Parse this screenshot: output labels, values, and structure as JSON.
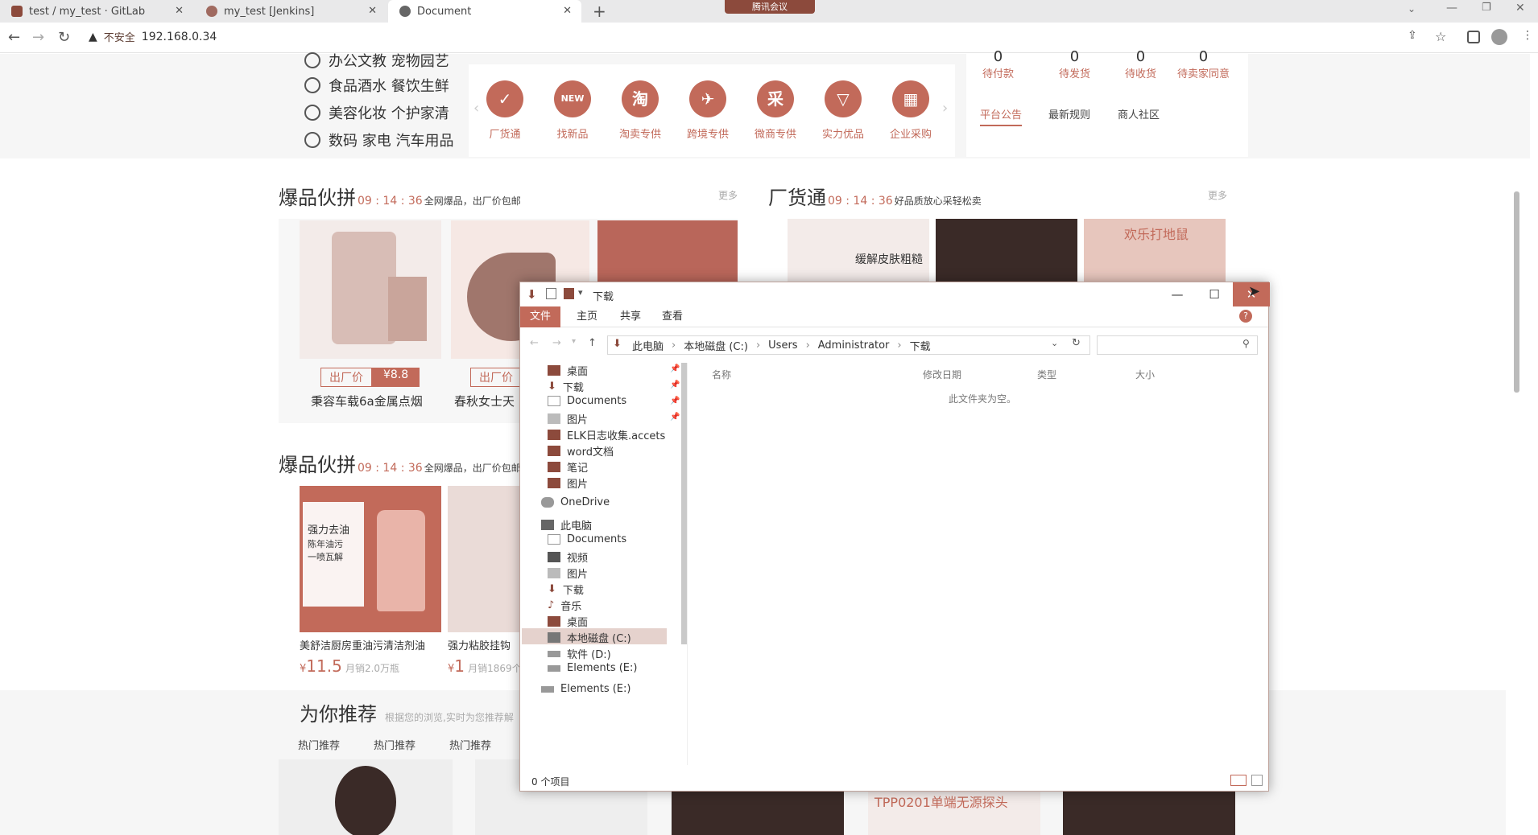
{
  "browser": {
    "tabs": [
      {
        "title": "test / my_test · GitLab",
        "color": "#8c4a3c"
      },
      {
        "title": "my_test [Jenkins]",
        "color": "#a06a60"
      },
      {
        "title": "Document",
        "color": "#666666"
      }
    ],
    "meeting_badge": "腾讯会议",
    "security_label": "不安全",
    "url": "192.168.0.34"
  },
  "page": {
    "categories": [
      "办公文教 宠物园艺",
      "食品酒水 餐饮生鲜",
      "美容化妆 个护家清",
      "数码 家电 汽车用品"
    ],
    "quick_icons": [
      {
        "label": "厂货通",
        "glyph": "✓"
      },
      {
        "label": "找新品",
        "glyph": "NEW"
      },
      {
        "label": "淘卖专供",
        "glyph": "淘"
      },
      {
        "label": "跨境专供",
        "glyph": "✈"
      },
      {
        "label": "微商专供",
        "glyph": "采"
      },
      {
        "label": "实力优品",
        "glyph": "▽"
      },
      {
        "label": "企业采购",
        "glyph": "▦"
      }
    ],
    "order_stats": [
      {
        "count": "0",
        "label": "待付款"
      },
      {
        "count": "0",
        "label": "待发货"
      },
      {
        "count": "0",
        "label": "待收货"
      },
      {
        "count": "0",
        "label": "待卖家同意"
      }
    ],
    "notice_tabs": [
      "平台公告",
      "最新规则",
      "商人社区"
    ],
    "section1": {
      "title": "爆品伙拼",
      "time": "09 : 14 : 36",
      "subtitle": "全网爆品，出厂价包邮",
      "more": "更多"
    },
    "section2": {
      "title": "厂货通",
      "time": "09 : 14 : 36",
      "subtitle": "好品质放心采轻松卖",
      "more": "更多"
    },
    "section3": {
      "title": "爆品伙拼",
      "time": "09 : 14 : 36",
      "subtitle": "全网爆品，出厂价包邮"
    },
    "products_row1": [
      {
        "name": "秉容车载6a金属点烟",
        "badge_label": "出厂价",
        "badge_price": "¥8.8"
      },
      {
        "name": "春秋女士天",
        "badge_label": "出厂价",
        "badge_price": ""
      }
    ],
    "products_row2": [
      {
        "name": "美舒洁厨房重油污清洁剂油",
        "price_sym": "¥",
        "price": "11.5",
        "sold": "月销2.0万瓶"
      },
      {
        "name": "强力粘胶挂钩",
        "price_sym": "¥",
        "price": "1",
        "sold": "月销1869个"
      }
    ],
    "banner_texts": [
      "缓解皮肤粗糙",
      "欢乐打地鼠",
      "强力去油",
      "陈年油污",
      "一喷瓦解",
      "TPP0201单端无源探头"
    ],
    "recommend": {
      "title": "为你推荐",
      "subtitle": "根据您的浏览,实时为您推荐解",
      "tabs": [
        "热门推荐",
        "热门推荐",
        "热门推荐"
      ]
    }
  },
  "explorer": {
    "title": "下载",
    "ribbon_tabs": [
      "文件",
      "主页",
      "共享",
      "查看"
    ],
    "breadcrumb": [
      "此电脑",
      "本地磁盘 (C:)",
      "Users",
      "Administrator",
      "下载"
    ],
    "nav_items": [
      {
        "label": "桌面",
        "pinned": true
      },
      {
        "label": "下载",
        "pinned": true
      },
      {
        "label": "Documents",
        "pinned": true
      },
      {
        "label": "图片",
        "pinned": true
      },
      {
        "label": "ELK日志收集.accets",
        "pinned": false
      },
      {
        "label": "word文档",
        "pinned": false
      },
      {
        "label": "笔记",
        "pinned": false
      },
      {
        "label": "图片",
        "pinned": false
      }
    ],
    "onedrive": "OneDrive",
    "this_pc": "此电脑",
    "pc_items": [
      "Documents",
      "视频",
      "图片",
      "下载",
      "音乐",
      "桌面",
      "本地磁盘 (C:)",
      "软件 (D:)",
      "Elements (E:)"
    ],
    "elements_root": "Elements (E:)",
    "columns": [
      "名称",
      "修改日期",
      "类型",
      "大小"
    ],
    "empty_message": "此文件夹为空。",
    "status": "0 个项目"
  }
}
